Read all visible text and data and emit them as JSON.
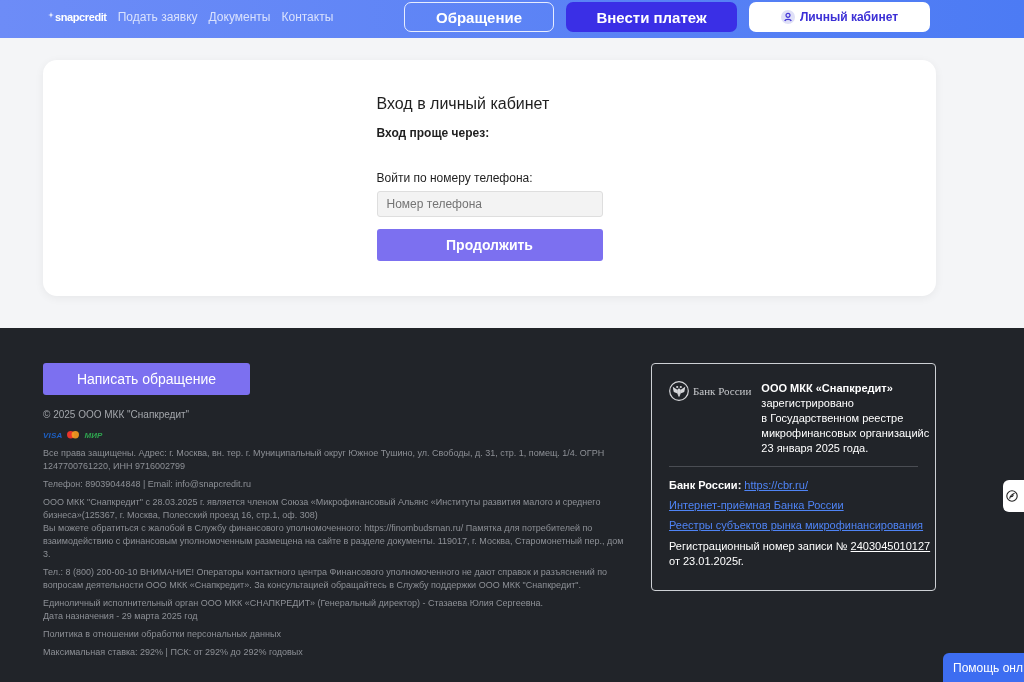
{
  "header": {
    "logo": "snapcredit",
    "nav": [
      "Подать заявку",
      "Документы",
      "Контакты"
    ],
    "buttons": [
      {
        "label": "Обращение",
        "kind": "outline"
      },
      {
        "label": "Внести платеж",
        "kind": "primary"
      },
      {
        "label": "Личный кабинет",
        "kind": "account"
      }
    ]
  },
  "login": {
    "title": "Вход в личный кабинет",
    "alt_title": "Вход проще через:",
    "phone_label": "Войти по номеру телефона:",
    "phone_field": {
      "placeholder": "Номер телефона"
    },
    "submit": "Продолжить"
  },
  "footer": {
    "appeal_button": "Написать обращение",
    "copyright": "© 2025 ООО МКК \"Снапкредит\"",
    "payment_logos": [
      {
        "kind": "visa",
        "text": "VISA"
      },
      {
        "kind": "mastercard"
      },
      {
        "kind": "mir",
        "text": "МИР"
      }
    ],
    "legal_text": [
      [
        "Все права защищены. Адрес: г. Москва, вн. тер. г. Муниципальный округ Южное Тушино, ул. Свободы, д. 31, стр. 1, помещ. 1/4. ОГРН 1247700761220, ИНН 9716002799"
      ],
      [
        "Телефон: 89039044848 | Email: info@snapcredit.ru"
      ],
      [
        "ООО МКК \"Снапкредит\" с 28.03.2025 г. является членом Союза «Микрофинансовый Альянс «Институты развития малого и среднего бизнеса»(125367, г. Москва, Полесский проезд 16, стр.1, оф. 308)",
        "Вы можете обратиться с жалобой в Службу финансового уполномоченного: https://finombudsman.ru/ Памятка для потребителей по взаимодействию с финансовым уполномоченным размещена на сайте в разделе документы. 119017, г. Москва, Старомонетный пер., дом 3."
      ],
      [
        "Тел.: 8 (800) 200-00-10 ВНИМАНИЕ! Операторы контактного центра Финансового уполномоченного не дают справок и разъяснений по вопросам деятельности ООО МКК «Снапкредит». За консультацией обращайтесь в Службу поддержки ООО МКК \"Снапкредит\"."
      ],
      [
        "Единоличный исполнительный орган ООО МКК «СНАПКРЕДИТ» (Генеральный директор) - Стазаева Юлия Сергеевна.",
        "Дата назначения - 29 марта 2025 год"
      ],
      [
        "Политика в отношении обработки персональных данных"
      ],
      [
        "Максимальная ставка: 292% | ПСК: от 292% до 292% годовых"
      ]
    ],
    "registry": {
      "bank_logo_text": "Банк России",
      "registration_lines": [
        "**ООО МКК «Снапкредит»**",
        "зарегистрировано",
        "в Государственном реестре",
        "микрофинансовых организацийс",
        "23 января 2025 года."
      ],
      "bank_site": {
        "label": "Банк России:",
        "link": "https://cbr.ru/"
      },
      "links": [
        "Интернет-приёмная Банка России",
        "Реестры субъектов рынка микрофинансирования"
      ],
      "record": {
        "text": "Регистрационный номер записи №",
        "number": "2403045010127",
        "date": "от 23.01.2025г."
      }
    }
  },
  "help_button": "Помощь онл"
}
